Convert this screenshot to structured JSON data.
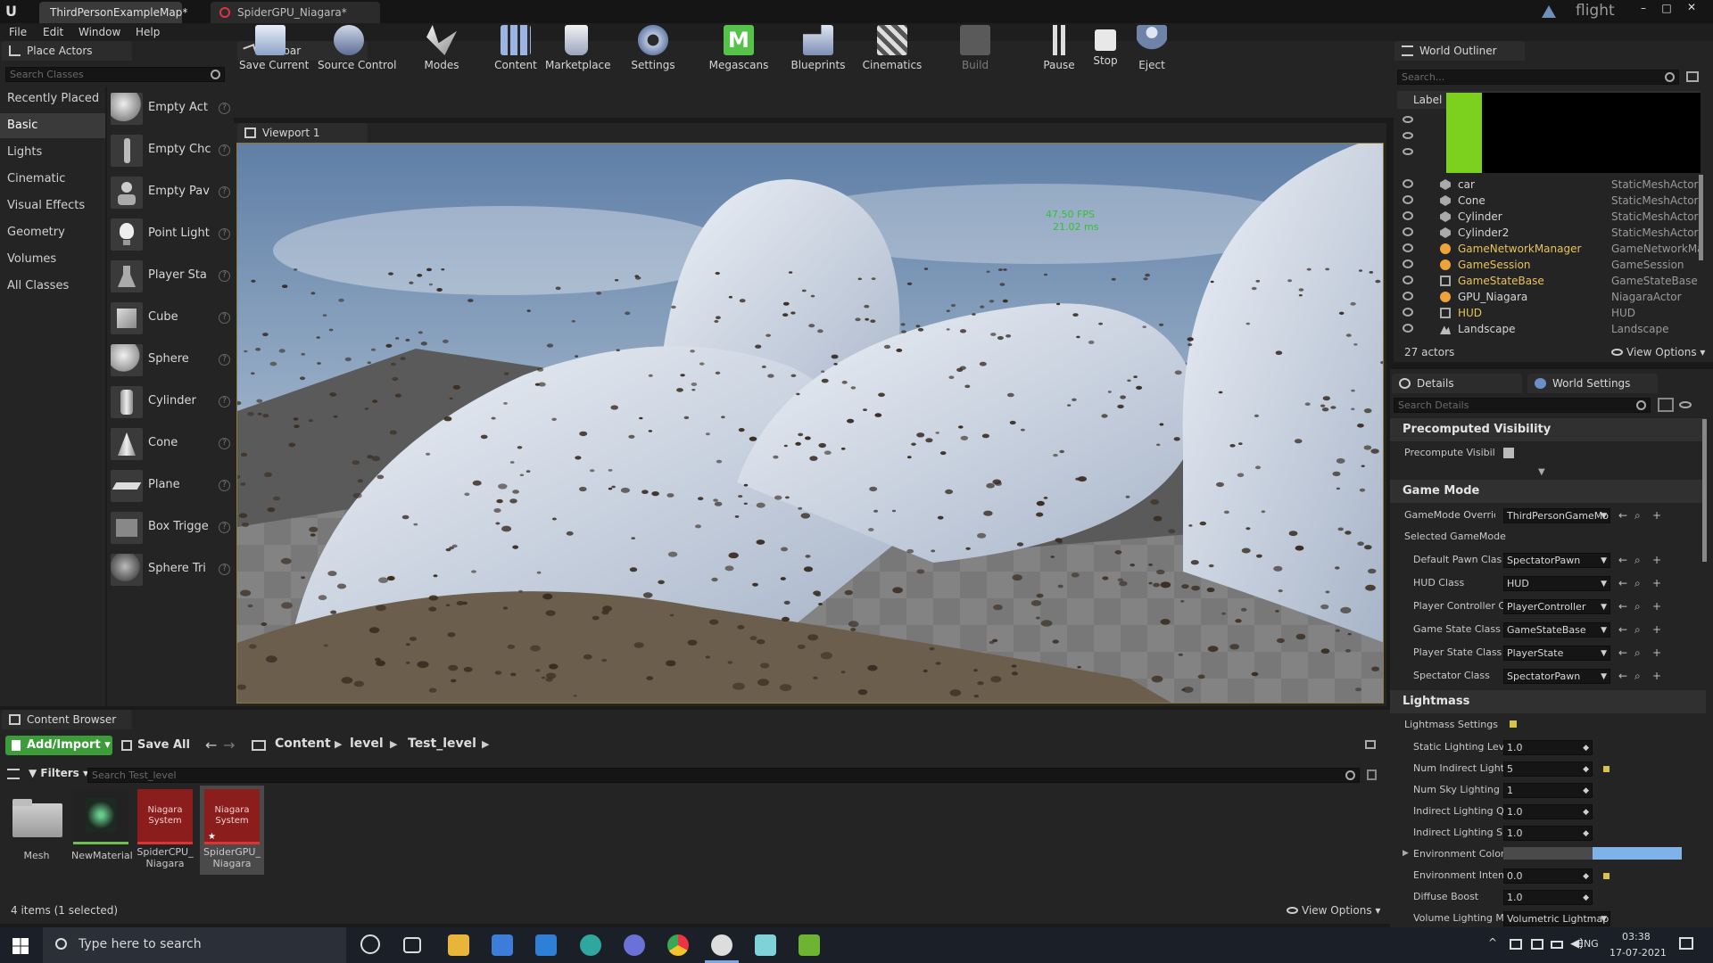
{
  "title_bar": {
    "tabs": [
      {
        "label": "ThirdPersonExampleMap*"
      },
      {
        "label": "SpiderGPU_Niagara*"
      }
    ],
    "project": "flight"
  },
  "menu": [
    "File",
    "Edit",
    "Window",
    "Help"
  ],
  "place_actors": {
    "tab": "Place Actors",
    "search_placeholder": "Search Classes",
    "categories": [
      "Recently Placed",
      "Basic",
      "Lights",
      "Cinematic",
      "Visual Effects",
      "Geometry",
      "Volumes",
      "All Classes"
    ],
    "selected_category": "Basic",
    "items": [
      "Empty Act",
      "Empty Chc",
      "Empty Pav",
      "Point Light",
      "Player Sta",
      "Cube",
      "Sphere",
      "Cylinder",
      "Cone",
      "Plane",
      "Box Trigge",
      "Sphere Tri"
    ]
  },
  "toolbar": {
    "tab": "Toolbar",
    "buttons": [
      "Save Current",
      "Source Control",
      "Modes",
      "Content",
      "Marketplace",
      "Settings",
      "Megascans",
      "Blueprints",
      "Cinematics",
      "Build",
      "Pause",
      "Stop",
      "Eject"
    ]
  },
  "viewport": {
    "tab": "Viewport 1",
    "fps": "47.50 FPS",
    "ms": "21.02 ms"
  },
  "outliner": {
    "tab": "World Outliner",
    "search_placeholder": "Search...",
    "column_label": "Label",
    "rows": [
      {
        "name": "car",
        "type": "StaticMeshActor"
      },
      {
        "name": "Cone",
        "type": "StaticMeshActor"
      },
      {
        "name": "Cylinder",
        "type": "StaticMeshActor"
      },
      {
        "name": "Cylinder2",
        "type": "StaticMeshActor"
      },
      {
        "name": "GameNetworkManager",
        "type": "GameNetworkMa"
      },
      {
        "name": "GameSession",
        "type": "GameSession"
      },
      {
        "name": "GameStateBase",
        "type": "GameStateBase"
      },
      {
        "name": "GPU_Niagara",
        "type": "NiagaraActor"
      },
      {
        "name": "HUD",
        "type": "HUD"
      },
      {
        "name": "Landscape",
        "type": "Landscape"
      }
    ],
    "count": "27 actors",
    "view_options": "View Options"
  },
  "details": {
    "tabs": [
      "Details",
      "World Settings"
    ],
    "search_placeholder": "Search Details",
    "precomputed": {
      "header": "Precomputed Visibility",
      "label": "Precompute Visibility"
    },
    "game_mode": {
      "header": "Game Mode",
      "override_label": "GameMode Override",
      "override_value": "ThirdPersonGameMo",
      "selected_header": "Selected GameMode",
      "props": [
        {
          "label": "Default Pawn Clas",
          "value": "SpectatorPawn"
        },
        {
          "label": "HUD Class",
          "value": "HUD"
        },
        {
          "label": "Player Controller C",
          "value": "PlayerController"
        },
        {
          "label": "Game State Class",
          "value": "GameStateBase"
        },
        {
          "label": "Player State Class",
          "value": "PlayerState"
        },
        {
          "label": "Spectator Class",
          "value": "SpectatorPawn"
        }
      ]
    },
    "lightmass": {
      "header": "Lightmass",
      "settings_header": "Lightmass Settings",
      "props": [
        {
          "label": "Static Lighting Lev",
          "value": "1.0"
        },
        {
          "label": "Num Indirect Light",
          "value": "5"
        },
        {
          "label": "Num Sky Lighting I",
          "value": "1"
        },
        {
          "label": "Indirect Lighting Qu",
          "value": "1.0"
        },
        {
          "label": "Indirect Lighting Sr",
          "value": "1.0"
        },
        {
          "label": "Environment Color",
          "value": ""
        },
        {
          "label": "Environment Intens",
          "value": "0.0"
        },
        {
          "label": "Diffuse Boost",
          "value": "1.0"
        },
        {
          "label": "Volume Lighting M",
          "value": "Volumetric Lightmap"
        }
      ]
    }
  },
  "content_browser": {
    "tab": "Content Browser",
    "add_import": "Add/Import",
    "save_all": "Save All",
    "breadcrumbs": [
      "Content",
      "level",
      "Test_level"
    ],
    "filters": "Filters",
    "search_placeholder": "Search Test_level",
    "assets": [
      {
        "label": "Mesh",
        "thumb": ""
      },
      {
        "label": "NewMaterial",
        "thumb": ""
      },
      {
        "label": "SpiderCPU_Niagara",
        "thumb": "Niagara System"
      },
      {
        "label": "SpiderGPU_Niagara",
        "thumb": "Niagara System"
      }
    ],
    "status": "4 items (1 selected)",
    "view_options": "View Options"
  },
  "taskbar": {
    "search_placeholder": "Type here to search",
    "lang": "ENG",
    "time": "03:38",
    "date": "17-07-2021"
  }
}
